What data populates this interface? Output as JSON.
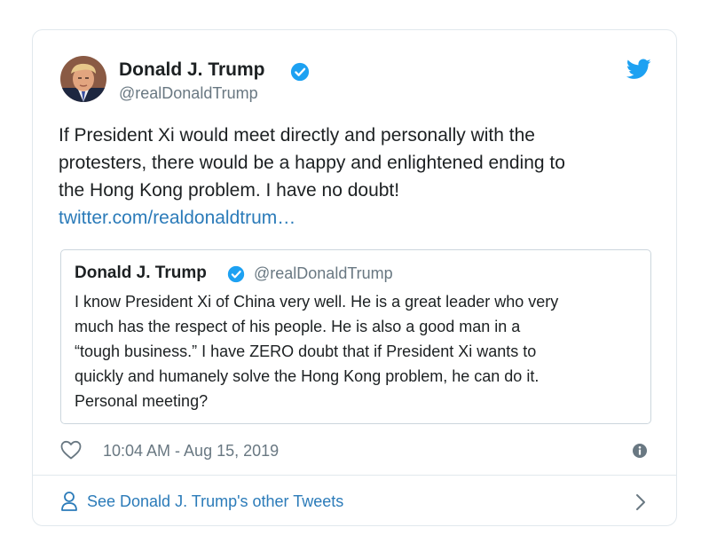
{
  "tweet": {
    "author": {
      "name": "Donald J. Trump",
      "handle": "@realDonaldTrump",
      "verified": true
    },
    "text_lines": [
      "If President Xi would meet directly and personally with the",
      "protesters, there would be a happy and enlightened ending to",
      "the Hong Kong problem. I have no doubt!"
    ],
    "link_text": "twitter.com/realdonaldtrum…",
    "quoted": {
      "author_name": "Donald J. Trump",
      "author_handle": "@realDonaldTrump",
      "text_lines": [
        "I know President Xi of China very well. He is a great leader who very",
        "much has the respect of his people. He is also a good man in a",
        "“tough business.” I have ZERO doubt that if President Xi wants to",
        "quickly and humanely solve the Hong Kong problem, he can do it.",
        "Personal meeting?"
      ]
    },
    "timestamp": "10:04 AM - Aug 15, 2019",
    "footer_link": "See Donald J. Trump's other Tweets"
  },
  "icons": {
    "avatar": "profile-photo",
    "verified": "verified-badge-icon",
    "brand": "twitter-bird-icon",
    "like": "heart-icon",
    "info": "info-icon",
    "person": "person-icon",
    "chevron": "chevron-right-icon"
  },
  "colors": {
    "link": "#2b7bb9",
    "verified": "#1da1f2",
    "text": "#1c2022",
    "secondary_text": "#697882",
    "border": "#e1e8ed"
  }
}
